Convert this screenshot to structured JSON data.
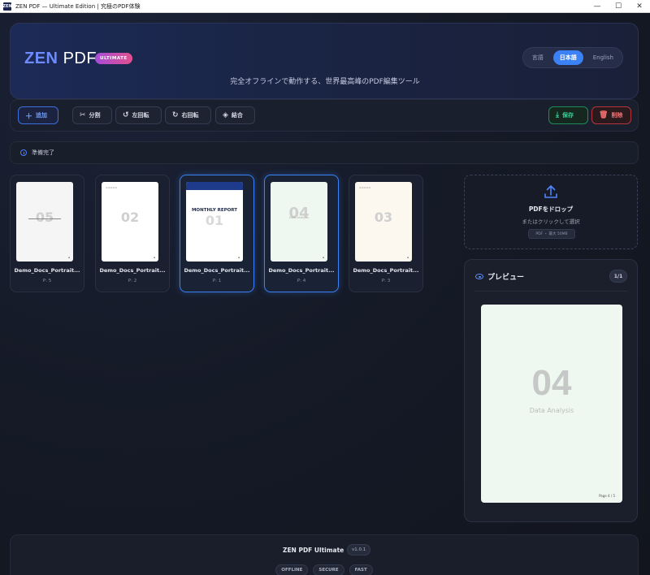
{
  "window": {
    "icon_text": "ZEN",
    "title": "ZEN PDF — Ultimate Edition | 究極のPDF体験",
    "controls": [
      "—",
      "☐",
      "✕"
    ]
  },
  "header": {
    "logo_zen": "ZEN",
    "logo_pdf": "PDF",
    "badge": "ULTIMATE",
    "tagline": "完全オフラインで動作する、世界最高峰のPDF編集ツール",
    "languages": [
      {
        "label": "言語",
        "active": false
      },
      {
        "label": "日本語",
        "active": true
      },
      {
        "label": "English",
        "active": false
      }
    ]
  },
  "toolbar": {
    "add": "追加",
    "split": "分割",
    "rotate_left": "左回転",
    "rotate_right": "右回転",
    "merge": "結合",
    "save": "保存",
    "delete": "削除"
  },
  "status": {
    "text": "準備完了"
  },
  "thumbnails": [
    {
      "number": "05",
      "name": "Demo_Docs_Portrait...",
      "page": "P: 5",
      "selected": false
    },
    {
      "number": "02",
      "name": "Demo_Docs_Portrait...",
      "page": "P: 2",
      "selected": false
    },
    {
      "number": "01",
      "title": "MONTHLY REPORT",
      "name": "Demo_Docs_Portrait...",
      "page": "P: 1",
      "selected": true
    },
    {
      "number": "04",
      "name": "Demo_Docs_Portrait...",
      "page": "P: 4",
      "selected": true
    },
    {
      "number": "03",
      "name": "Demo_Docs_Portrait...",
      "page": "P: 3",
      "selected": false
    }
  ],
  "dropzone": {
    "title": "PDFをドロップ",
    "subtitle": "またはクリックして選択",
    "chip": "PDF ・ 最大 50MB"
  },
  "preview": {
    "title": "プレビュー",
    "count": "1/1",
    "page_number": "04",
    "page_subtitle": "Data Analysis",
    "page_footer": "Page 4 / 5"
  },
  "footer": {
    "title": "ZEN PDF Ultimate",
    "version": "v1.0.1",
    "tags": [
      "OFFLINE",
      "SECURE",
      "FAST"
    ]
  }
}
